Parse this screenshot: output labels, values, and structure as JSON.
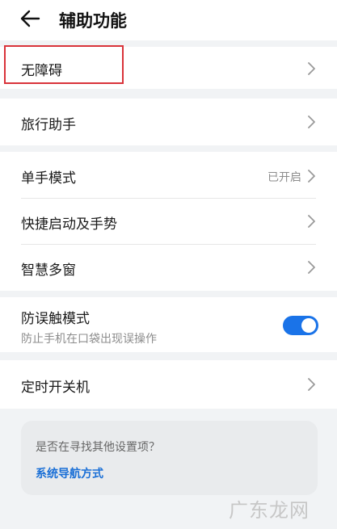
{
  "header": {
    "title": "辅助功能",
    "back_icon": "back-arrow-icon"
  },
  "groups": [
    {
      "items": [
        {
          "label": "无障碍"
        }
      ]
    },
    {
      "items": [
        {
          "label": "旅行助手"
        }
      ]
    },
    {
      "items": [
        {
          "label": "单手模式",
          "value": "已开启"
        },
        {
          "label": "快捷启动及手势"
        },
        {
          "label": "智慧多窗"
        }
      ]
    },
    {
      "items": [
        {
          "label": "防误触模式",
          "subtitle": "防止手机在口袋出现误操作",
          "toggle_on": true
        }
      ]
    },
    {
      "items": [
        {
          "label": "定时开关机"
        }
      ]
    }
  ],
  "hint": {
    "question": "是否在寻找其他设置项？",
    "link": "系统导航方式"
  },
  "watermark": "广东龙网",
  "colors": {
    "accent": "#1a73e8",
    "link": "#1a6fd6",
    "highlight": "#d9333a",
    "background": "#f1f3f5"
  }
}
